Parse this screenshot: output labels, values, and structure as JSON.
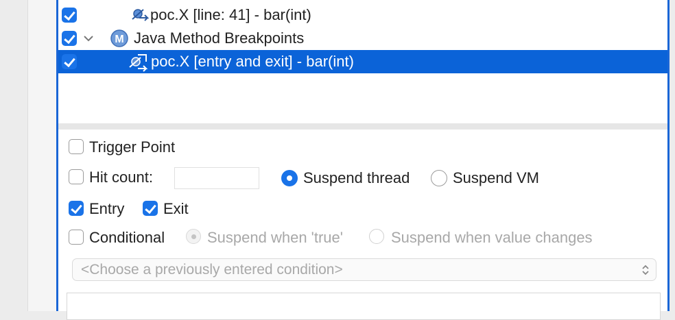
{
  "tree": {
    "rows": [
      {
        "label": "poc.X [line: 41] - bar(int)",
        "checked": true,
        "icon": "line-breakpoint-icon"
      },
      {
        "label": "Java Method Breakpoints",
        "checked": true,
        "icon": "method-category-icon",
        "badge": "M",
        "expanded": true
      },
      {
        "label": "poc.X [entry and exit] - bar(int)",
        "checked": true,
        "icon": "method-breakpoint-icon",
        "selected": true
      }
    ]
  },
  "properties": {
    "trigger_point": {
      "label": "Trigger Point",
      "checked": false
    },
    "hit_count": {
      "label": "Hit count:",
      "checked": false,
      "value": ""
    },
    "suspend_thread": {
      "label": "Suspend thread",
      "selected": true
    },
    "suspend_vm": {
      "label": "Suspend VM",
      "selected": false
    },
    "entry": {
      "label": "Entry",
      "checked": true
    },
    "exit": {
      "label": "Exit",
      "checked": true
    },
    "conditional": {
      "label": "Conditional",
      "checked": false
    },
    "suspend_when_true": {
      "label": "Suspend when 'true'",
      "selected": true,
      "disabled": true
    },
    "suspend_when_changes": {
      "label": "Suspend when value changes",
      "selected": false,
      "disabled": true
    },
    "condition_combo": {
      "placeholder": "<Choose a previously entered condition>"
    }
  },
  "colors": {
    "selection": "#0b63d8",
    "accent": "#1a73e8",
    "frame": "#1a66d6"
  }
}
